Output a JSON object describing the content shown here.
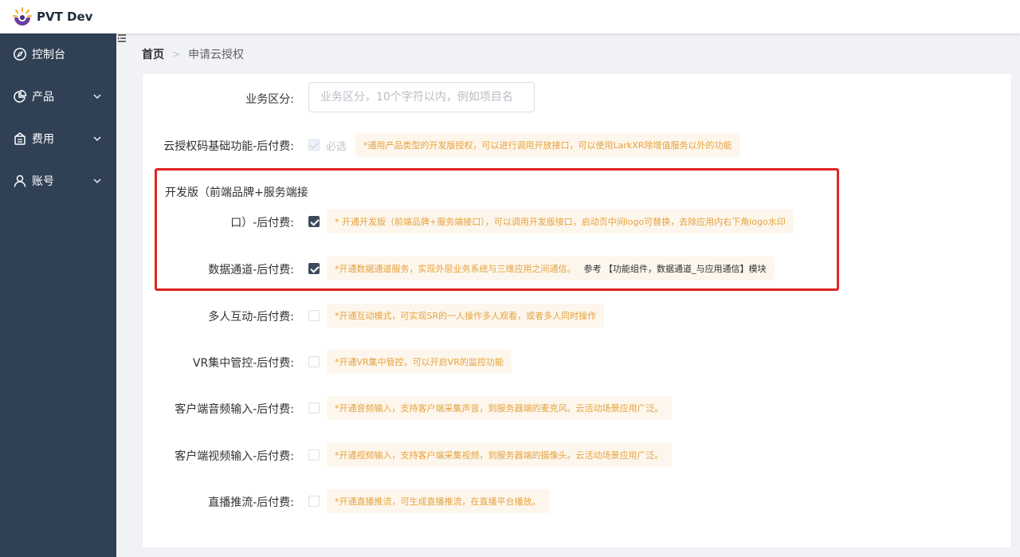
{
  "app": {
    "name": "PVT Dev"
  },
  "sidebar": {
    "items": [
      {
        "label": "控制台",
        "icon": "compass-icon",
        "has_submenu": false
      },
      {
        "label": "产品",
        "icon": "pie-chart-icon",
        "has_submenu": true
      },
      {
        "label": "费用",
        "icon": "wallet-icon",
        "has_submenu": true
      },
      {
        "label": "账号",
        "icon": "user-icon",
        "has_submenu": true
      }
    ],
    "bg_color": "#304156"
  },
  "breadcrumb": {
    "home": "首页",
    "separator": ">",
    "current": "申请云授权"
  },
  "form": {
    "business": {
      "label": "业务区分:",
      "placeholder": "业务区分，10个字符以内，例如项目名",
      "value": ""
    },
    "base": {
      "label": "云授权码基础功能-后付费:",
      "checkbox_text": "必选",
      "checked": true,
      "disabled": true,
      "hint": "*通用产品类型的开发版授权，可以进行调用开放接口，可以使用LarkXR除增值服务以外的功能"
    },
    "dev": {
      "label_line1": "开发版（前端品牌+服务端接",
      "label_line2": "口）-后付费:",
      "checked": true,
      "hint": "* 开通开发版（前端品牌+服务端接口），可以调用开发版接口，启动页中间logo可替换，去除应用内右下角logo水印"
    },
    "datachannel": {
      "label": "数据通道-后付费:",
      "checked": true,
      "hint": "*开通数据通道服务，实现外层业务系统与三维应用之间通信。",
      "hint_extra": "参考 【功能组件，数据通道_与应用通信】模块"
    },
    "multiplayer": {
      "label": "多人互动-后付费:",
      "checked": false,
      "hint": "*开通互动模式，可实现SR的一人操作多人观看，或者多人同时操作"
    },
    "vr": {
      "label": "VR集中管控-后付费:",
      "checked": false,
      "hint": "*开通VR集中管控，可以开启VR的监控功能"
    },
    "audio": {
      "label": "客户端音频输入-后付费:",
      "checked": false,
      "hint": "*开通音频输入，支持客户端采集声音，到服务器端的麦克风。云活动场景应用广泛。"
    },
    "video": {
      "label": "客户端视频输入-后付费:",
      "checked": false,
      "hint": "*开通视频输入，支持客户端采集视频，到服务器端的摄像头。云活动场景应用广泛。"
    },
    "live": {
      "label": "直播推流-后付费:",
      "checked": false,
      "hint": "*开通直播推流，可生成直播推流，在直播平台播放。"
    }
  },
  "colors": {
    "accent": "#3c4a5e",
    "hint_text": "#e6a23c",
    "hint_bg": "#fdf6ec",
    "highlight": "#e02424"
  }
}
